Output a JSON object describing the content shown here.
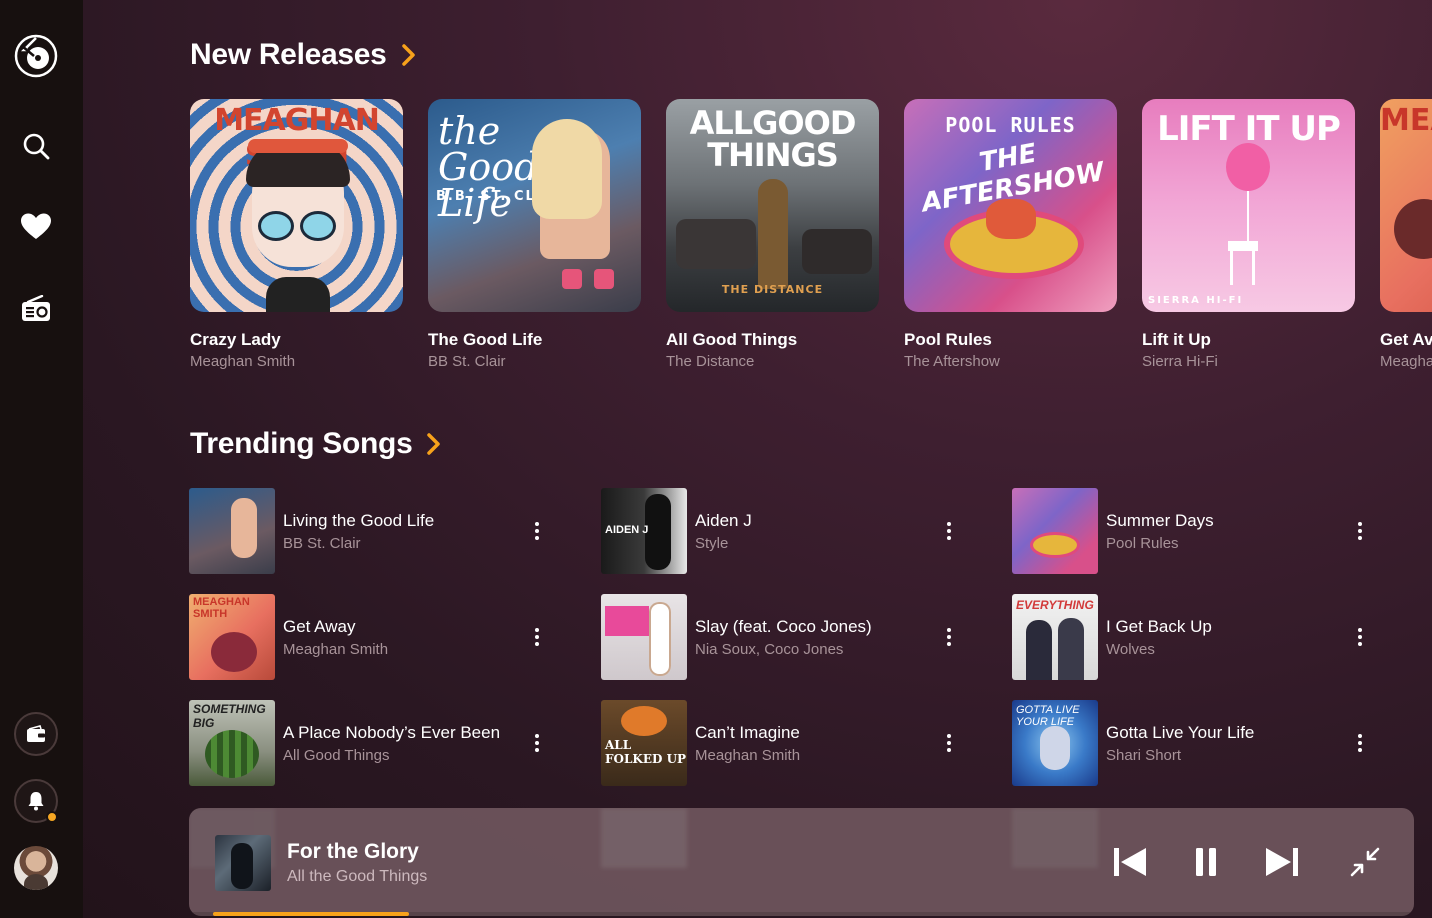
{
  "sidebar": {
    "items": [
      {
        "name": "logo",
        "icon": "vinyl-logo-icon"
      },
      {
        "name": "search",
        "icon": "search-icon"
      },
      {
        "name": "favorites",
        "icon": "heart-icon"
      },
      {
        "name": "radio",
        "icon": "radio-icon"
      },
      {
        "name": "wallet",
        "icon": "wallet-icon"
      },
      {
        "name": "notifications",
        "icon": "bell-icon"
      },
      {
        "name": "profile",
        "icon": "avatar"
      }
    ]
  },
  "new_releases": {
    "title": "New Releases",
    "albums": [
      {
        "title": "Crazy Lady",
        "artist": "Meaghan Smith",
        "cover_text": "MEAGHAN SMITH"
      },
      {
        "title": "The Good Life",
        "artist": "BB St. Clair",
        "cover_text": "the Good Life",
        "cover_sub": "B.B. ST. CLAIR"
      },
      {
        "title": "All Good Things",
        "artist": "The Distance",
        "cover_text": "ALLGOOD THINGS",
        "cover_sub": "THE DISTANCE"
      },
      {
        "title": "Pool Rules",
        "artist": "The Aftershow",
        "cover_text": "POOL RULES",
        "cover_sub": "THE AFTERSHOW"
      },
      {
        "title": "Lift it Up",
        "artist": "Sierra Hi-Fi",
        "cover_text": "LIFT IT UP",
        "cover_sub": "SIERRA HI-FI"
      },
      {
        "title": "Get Av",
        "artist": "Meagha",
        "cover_text": "MEA"
      }
    ]
  },
  "trending": {
    "title": "Trending Songs",
    "songs": [
      {
        "title": "Living the Good Life",
        "artist": "BB St. Clair"
      },
      {
        "title": "Aiden J",
        "artist": "Style"
      },
      {
        "title": "Summer Days",
        "artist": "Pool Rules"
      },
      {
        "title": "Get Away",
        "artist": "Meaghan Smith"
      },
      {
        "title": "Slay (feat. Coco Jones)",
        "artist": "Nia Soux, Coco Jones"
      },
      {
        "title": "I Get Back Up",
        "artist": "Wolves"
      },
      {
        "title": "A Place Nobody’s Ever Been",
        "artist": "All Good Things"
      },
      {
        "title": "Can’t Imagine",
        "artist": "Meaghan Smith"
      },
      {
        "title": "Gotta Live Your Life",
        "artist": "Shari Short"
      }
    ]
  },
  "player": {
    "title": "For the Glory",
    "artist": "All the Good Things",
    "progress": 0.16,
    "controls": [
      "previous",
      "pause",
      "next",
      "minimize"
    ]
  },
  "colors": {
    "accent": "#f7a21b",
    "sidebar": "#17100f",
    "player": "#6e555c"
  }
}
